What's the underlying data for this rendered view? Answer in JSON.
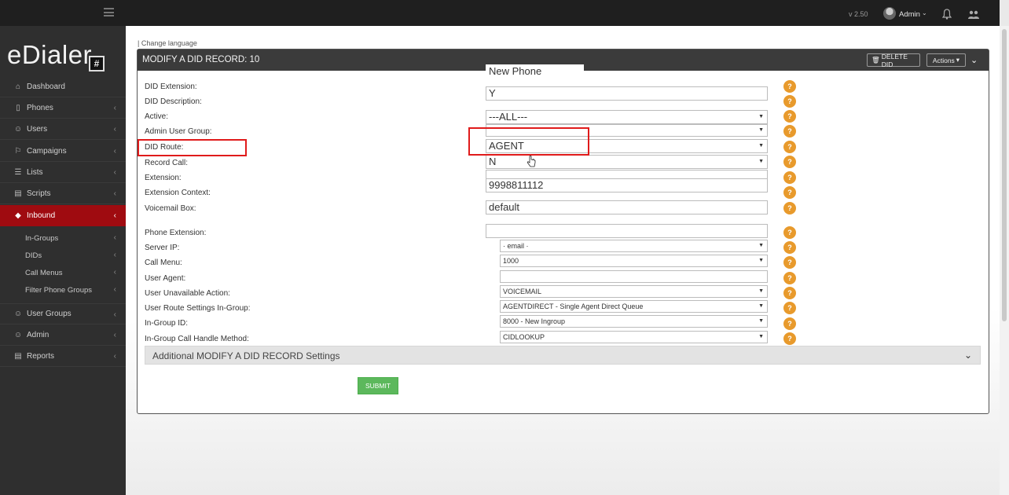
{
  "topbar": {
    "version": "v 2.50",
    "user": "Admin",
    "user_caret": "⌄"
  },
  "sidebar": {
    "logo": "eDialer",
    "logo_badge": "#",
    "items": [
      {
        "label": "Dashboard",
        "icon": "home-icon"
      },
      {
        "label": "Phones",
        "icon": "phone-icon"
      },
      {
        "label": "Users",
        "icon": "users-icon"
      },
      {
        "label": "Campaigns",
        "icon": "flag-icon"
      },
      {
        "label": "Lists",
        "icon": "list-icon"
      },
      {
        "label": "Scripts",
        "icon": "script-icon"
      },
      {
        "label": "Inbound",
        "icon": "diamond-icon",
        "active": true
      },
      {
        "label": "User Groups",
        "icon": "user-groups-icon"
      },
      {
        "label": "Admin",
        "icon": "admin-icon"
      },
      {
        "label": "Reports",
        "icon": "reports-icon"
      }
    ],
    "inbound_sub": [
      "In-Groups",
      "DIDs",
      "Call Menus",
      "Filter Phone Groups"
    ],
    "chevron": "‹"
  },
  "page": {
    "change_language": "| Change language",
    "panel_title": "MODIFY A DID RECORD: 10",
    "delete_button": "DELETE DID",
    "actions_button": "Actions",
    "accent_red": "#9f0b10",
    "help_color": "#e89a2c"
  },
  "form": {
    "labels": {
      "did_extension": "DID Extension:",
      "did_description": "DID Description:",
      "active": "Active:",
      "admin_user_group": "Admin User Group:",
      "did_route": "DID Route:",
      "record_call": "Record Call:",
      "extension": "Extension:",
      "extension_context": "Extension Context:",
      "voicemail_box": "Voicemail Box:",
      "phone_extension": "Phone Extension:",
      "server_ip": "Server IP:",
      "call_menu": "Call Menu:",
      "user_agent": "User Agent:",
      "user_unavailable_action": "User Unavailable Action:",
      "user_route_settings": "User Route Settings In-Group:",
      "ingroup_id": "In-Group ID:",
      "ingroup_call_handle": "In-Group Call Handle Method:"
    },
    "values": {
      "did_extension": "New Phone",
      "did_description": "Y",
      "active": "---ALL---",
      "admin_user_group": "",
      "did_route": "AGENT",
      "record_call": "N",
      "extension": "9998811112",
      "extension_context": "",
      "voicemail_box": "default",
      "phone_extension": "",
      "server_ip": "· email ·",
      "call_menu": "1000",
      "user_agent": "",
      "user_unavailable_action": "VOICEMAIL",
      "user_route_settings": "AGENTDIRECT - Single Agent Direct Queue",
      "ingroup_id": "8000 - New Ingroup",
      "ingroup_call_handle": "CIDLOOKUP"
    },
    "help": "?",
    "additional_settings": "Additional MODIFY A DID RECORD Settings",
    "submit": "SUBMIT"
  }
}
